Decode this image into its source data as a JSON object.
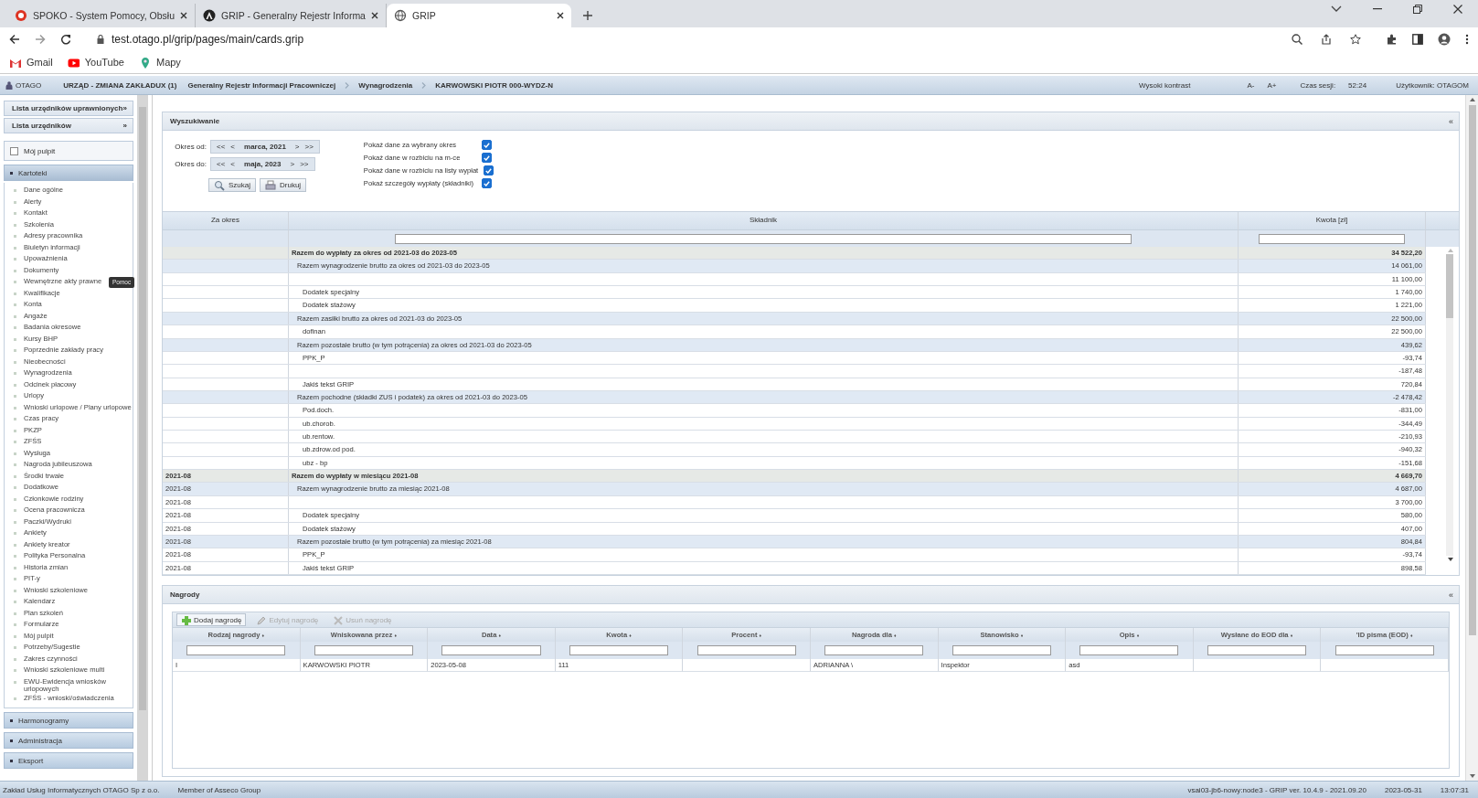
{
  "browser": {
    "tabs": [
      {
        "title": "SPOKO - System Pomocy, Obsłu",
        "selected": false
      },
      {
        "title": "GRIP - Generalny Rejestr Informa",
        "selected": false
      },
      {
        "title": "GRIP",
        "selected": true
      }
    ],
    "url": "test.otago.pl/grip/pages/main/cards.grip",
    "bookmarks": [
      {
        "label": "Gmail"
      },
      {
        "label": "YouTube"
      },
      {
        "label": "Mapy"
      }
    ]
  },
  "app_header": {
    "logo": "OTAGO",
    "office": "URZĄD - ZMIANA ZAKŁADUX (1)",
    "breadcrumb": [
      "Generalny Rejestr Informacji Pracowniczej",
      "Wynagrodzenia",
      "KARWOWSKI PIOTR 000-WYDZ-N"
    ],
    "contrast": "Wysoki kontrast",
    "font_smaller": "A-",
    "font_larger": "A+",
    "session_label": "Czas sesji:",
    "session_time": "52:24",
    "user": "Użytkownik: OTAGOM"
  },
  "sidebar": {
    "lists": [
      {
        "label": "Lista urzędników uprawnionych",
        "arrow": "»"
      },
      {
        "label": "Lista urzędników",
        "arrow": "»"
      }
    ],
    "desktop": {
      "label": "Mój pulpit",
      "checked": false
    },
    "tooltip": "Pomoc",
    "sections": [
      {
        "label": "Kartoteki",
        "expanded": true,
        "children": [
          {
            "label": "Dane ogólne"
          },
          {
            "label": "Alerty"
          },
          {
            "label": "Kontakt"
          },
          {
            "label": "Szkolenia"
          },
          {
            "label": "Adresy pracownika"
          },
          {
            "label": "Biuletyn informacji"
          },
          {
            "label": "Upoważnienia"
          },
          {
            "label": "Dokumenty"
          },
          {
            "label": "Wewnętrzne akty prawne",
            "tooltip": true
          },
          {
            "label": "Kwalifikacje"
          },
          {
            "label": "Konta"
          },
          {
            "label": "Angaże"
          },
          {
            "label": "Badania okresowe"
          },
          {
            "label": "Kursy BHP"
          },
          {
            "label": "Poprzednie zakłady pracy"
          },
          {
            "label": "Nieobecności"
          },
          {
            "label": "Wynagrodzenia"
          },
          {
            "label": "Odcinek płacowy"
          },
          {
            "label": "Urlopy"
          },
          {
            "label": "Wnioski urlopowe / Plany urlopowe"
          },
          {
            "label": "Czas pracy"
          },
          {
            "label": "PKZP"
          },
          {
            "label": "ZFŚS"
          },
          {
            "label": "Wysługa"
          },
          {
            "label": "Nagroda jubileuszowa"
          },
          {
            "label": "Środki trwałe"
          },
          {
            "label": "Dodatkowe"
          },
          {
            "label": "Członkowie rodziny"
          },
          {
            "label": "Ocena pracownicza"
          },
          {
            "label": "Paczki/Wydruki"
          },
          {
            "label": "Ankiety"
          },
          {
            "label": "Ankiety kreator"
          },
          {
            "label": "Polityka Personalna"
          },
          {
            "label": "Historia zmian"
          },
          {
            "label": "PIT-y"
          },
          {
            "label": "Wnioski szkoleniowe"
          },
          {
            "label": "Kalendarz"
          },
          {
            "label": "Plan szkoleń"
          },
          {
            "label": "Formularze"
          },
          {
            "label": "Mój pulpit"
          },
          {
            "label": "Potrzeby/Sugestie"
          },
          {
            "label": "Zakres czynności"
          },
          {
            "label": "Wnioski szkoleniowe multi"
          },
          {
            "label": "EWU-Ewidencja wniosków urlopowych"
          },
          {
            "label": "ZFŚS - wnioski/oświadczenia"
          }
        ]
      },
      {
        "label": "Harmonogramy",
        "expanded": false
      },
      {
        "label": "Administracja",
        "expanded": false
      },
      {
        "label": "Eksport",
        "expanded": false
      }
    ]
  },
  "search_panel": {
    "title": "Wyszukiwanie",
    "collapse": "«",
    "periods": [
      {
        "label": "Okres od:",
        "first": "<<",
        "prev": "<",
        "value": "marca, 2021",
        "next": ">",
        "last": ">>"
      },
      {
        "label": "Okres do:",
        "first": "<<",
        "prev": "<",
        "value": "maja, 2023",
        "next": ">",
        "last": ">>"
      }
    ],
    "buttons": [
      {
        "label": "Szukaj"
      },
      {
        "label": "Drukuj"
      }
    ],
    "options": [
      {
        "label": "Pokaż dane za wybrany okres",
        "checked": true
      },
      {
        "label": "Pokaż dane w rozbiciu na m-ce",
        "checked": true
      },
      {
        "label": "Pokaż dane w rozbiciu na listy wypłat",
        "checked": true
      },
      {
        "label": "Pokaż szczegóły wypłaty (składniki)",
        "checked": true
      }
    ],
    "table": {
      "columns": [
        "Za okres",
        "Składnik",
        "Kwota [zł]"
      ],
      "rows": [
        {
          "kind": "total",
          "component": "Razem do wypłaty za okres od 2021-03 do 2023-05",
          "amount": "34 522,20"
        },
        {
          "kind": "subtotal",
          "component": "Razem wynagrodzenie brutto za okres od 2021-03 do 2023-05",
          "amount": "14 061,00"
        },
        {
          "kind": "item",
          "amount": "11 100,00"
        },
        {
          "kind": "item",
          "component": "Dodatek specjalny",
          "amount": "1 740,00"
        },
        {
          "kind": "item",
          "component": "Dodatek stażowy",
          "amount": "1 221,00"
        },
        {
          "kind": "subtotal",
          "component": "Razem zasiłki brutto za okres od 2021-03 do 2023-05",
          "amount": "22 500,00"
        },
        {
          "kind": "item",
          "component": "dofinan",
          "amount": "22 500,00"
        },
        {
          "kind": "subtotal",
          "component": "Razem pozostałe brutto (w tym potrącenia) za okres od 2021-03 do 2023-05",
          "amount": "439,62"
        },
        {
          "kind": "item",
          "component": "PPK_P",
          "amount": "-93,74"
        },
        {
          "kind": "item",
          "amount": "-187,48"
        },
        {
          "kind": "item",
          "component": "Jakiś tekst GRIP",
          "amount": "720,84"
        },
        {
          "kind": "subtotal",
          "component": "Razem pochodne (składki ZUS i podatek) za okres od 2021-03 do 2023-05",
          "amount": "-2 478,42"
        },
        {
          "kind": "item",
          "component": "Pod.doch.",
          "amount": "-831,00"
        },
        {
          "kind": "item",
          "component": "ub.chorob.",
          "amount": "-344,49"
        },
        {
          "kind": "item",
          "component": "ub.rentow.",
          "amount": "-210,93"
        },
        {
          "kind": "item",
          "component": "ub.zdrow.od pod.",
          "amount": "-940,32"
        },
        {
          "kind": "item",
          "component": "ubz - bp",
          "amount": "-151,68"
        },
        {
          "kind": "total",
          "period": "2021-08",
          "component": "Razem do wypłaty w miesiącu 2021-08",
          "amount": "4 669,70"
        },
        {
          "kind": "subtotal",
          "period": "2021-08",
          "component": "Razem wynagrodzenie brutto za miesiąc 2021-08",
          "amount": "4 687,00"
        },
        {
          "kind": "item",
          "period": "2021-08",
          "amount": "3 700,00"
        },
        {
          "kind": "item",
          "period": "2021-08",
          "component": "Dodatek specjalny",
          "amount": "580,00"
        },
        {
          "kind": "item",
          "period": "2021-08",
          "component": "Dodatek stażowy",
          "amount": "407,00"
        },
        {
          "kind": "subtotal",
          "period": "2021-08",
          "component": "Razem pozostałe brutto (w tym potrącenia) za miesiąc 2021-08",
          "amount": "804,84"
        },
        {
          "kind": "item",
          "period": "2021-08",
          "component": "PPK_P",
          "amount": "-93,74"
        },
        {
          "kind": "item",
          "period": "2021-08",
          "component": "Jakiś tekst GRIP",
          "amount": "898,58"
        }
      ]
    }
  },
  "awards_panel": {
    "title": "Nagrody",
    "collapse": "«",
    "toolbar": [
      {
        "label": "Dodaj nagrodę",
        "disabled": false
      },
      {
        "label": "Edytuj nagrodę",
        "disabled": true
      },
      {
        "label": "Usuń nagrodę",
        "disabled": true
      }
    ],
    "columns": [
      "Rodzaj nagrody",
      "Wniskowana przez",
      "Data",
      "Kwota",
      "Procent",
      "Nagroda dla",
      "Stanowisko",
      "Opis",
      "Wysłane do EOD dla",
      "'ID pisma (EOD)"
    ],
    "sort_mark": "♦",
    "rows": [
      [
        "I",
        "KARWOWSKI PIOTR",
        "2023-05-08",
        "111",
        "",
        "ADRIANNA \\",
        "Inspektor",
        "asd",
        "",
        ""
      ]
    ]
  },
  "status_bar": {
    "company": "Zakład Usług Informatycznych OTAGO Sp z o.o.",
    "group": "Member of Asseco Group",
    "version": "vsai03-jb6-nowy:node3 - GRIP ver. 10.4.9 - 2021.09.20",
    "date": "2023-05-31",
    "time": "13:07:31"
  }
}
